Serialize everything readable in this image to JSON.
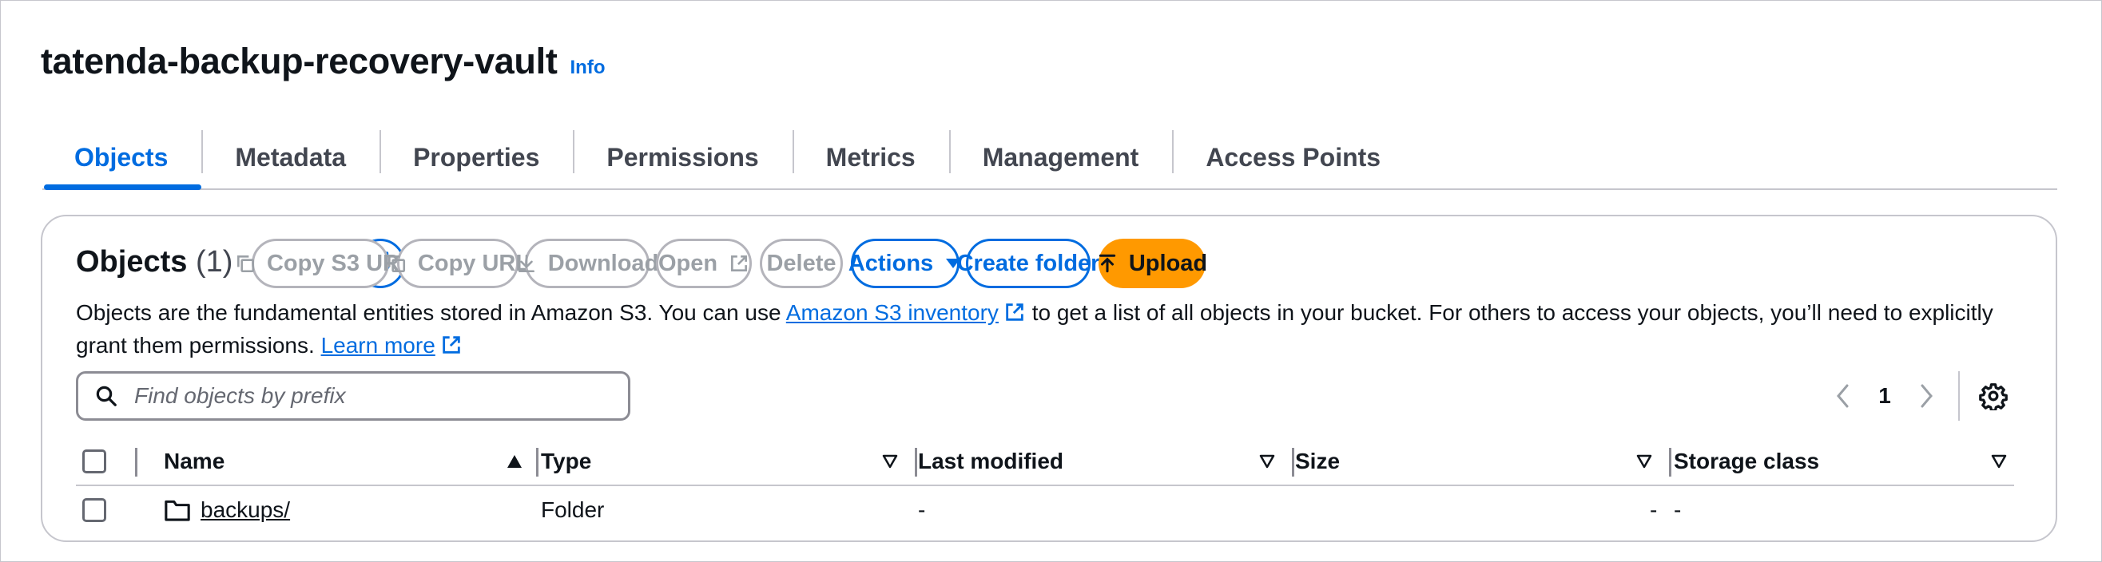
{
  "page": {
    "bucket_name": "tatenda-backup-recovery-vault",
    "info_label": "Info"
  },
  "tabs": [
    {
      "label": "Objects",
      "active": true
    },
    {
      "label": "Metadata"
    },
    {
      "label": "Properties"
    },
    {
      "label": "Permissions"
    },
    {
      "label": "Metrics"
    },
    {
      "label": "Management"
    },
    {
      "label": "Access Points"
    }
  ],
  "objects_panel": {
    "title": "Objects",
    "count": "(1)",
    "toolbar": {
      "refresh_icon": "refresh-icon",
      "copy_s3_uri": "Copy S3 URI",
      "copy_url": "Copy URL",
      "download": "Download",
      "open": "Open",
      "delete": "Delete",
      "actions": "Actions",
      "create_folder": "Create folder",
      "upload": "Upload"
    },
    "description": {
      "part1": "Objects are the fundamental entities stored in Amazon S3. You can use ",
      "link1": "Amazon S3 inventory",
      "part2": " to get a list of all objects in your bucket. For others to access your objects, you’ll need to explicitly grant them permissions. ",
      "link2": "Learn more"
    },
    "search": {
      "placeholder": "Find objects by prefix",
      "value": ""
    },
    "pagination": {
      "current_page": "1"
    },
    "table": {
      "columns": [
        "Name",
        "Type",
        "Last modified",
        "Size",
        "Storage class"
      ],
      "rows": [
        {
          "name": "backups/",
          "type": "Folder",
          "last_modified": "-",
          "size": "-",
          "storage_class": "-"
        }
      ]
    },
    "colors": {
      "accent": "#006ce0",
      "upload": "#ff9900",
      "disabled": "#9ba0a6"
    }
  }
}
